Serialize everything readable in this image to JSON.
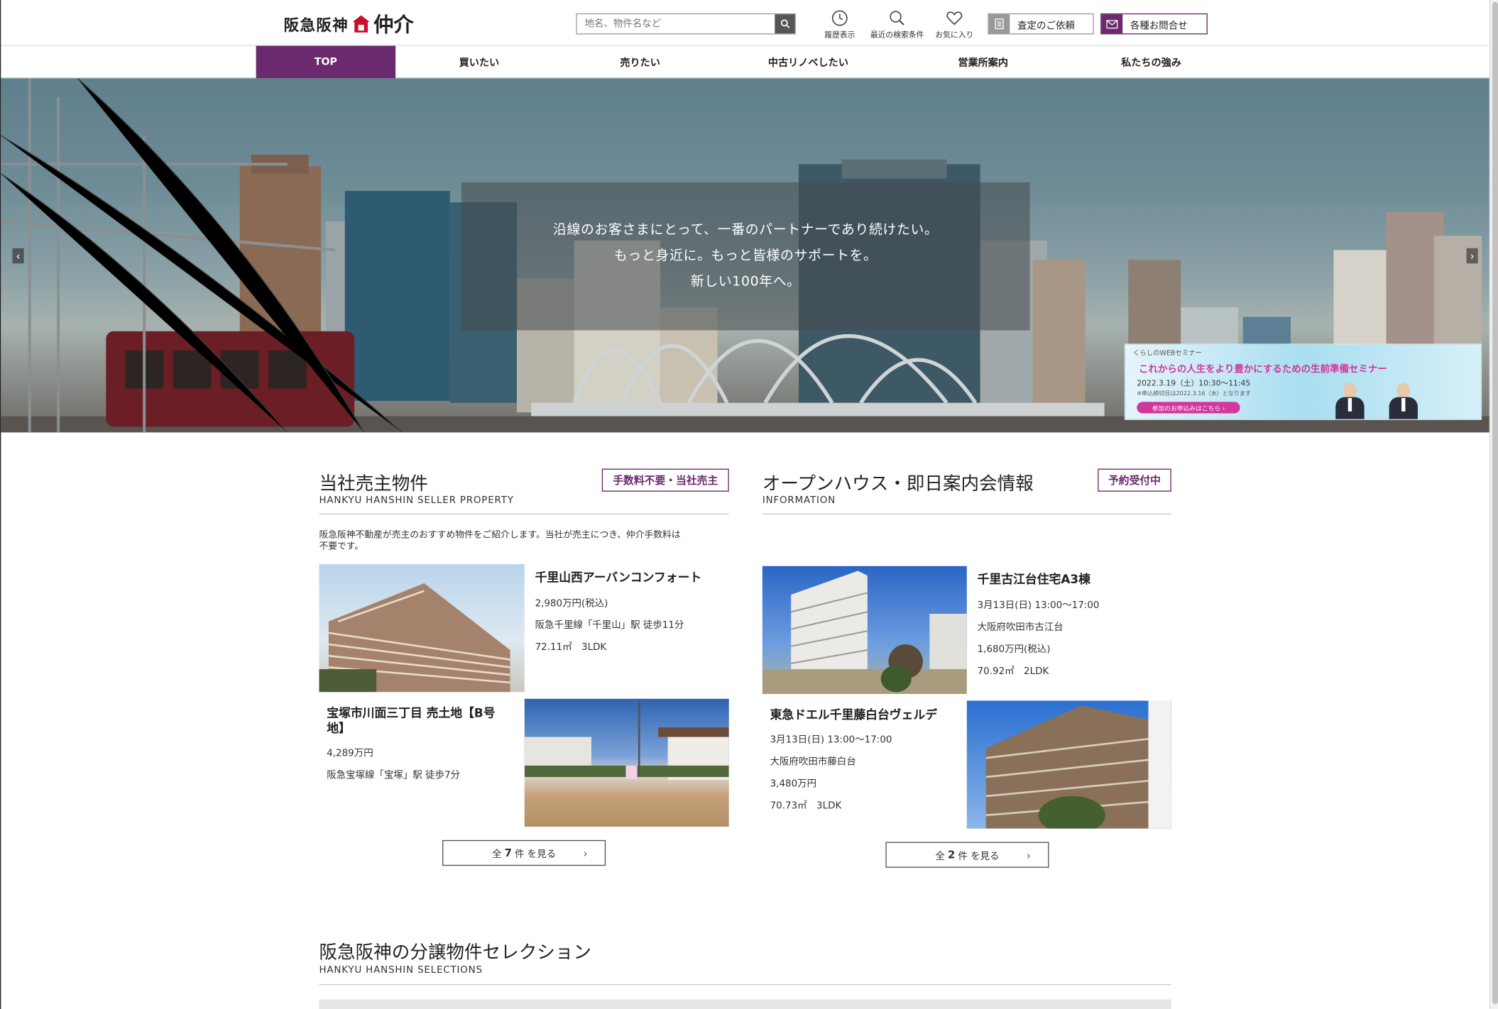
{
  "header": {
    "logo_part1": "阪急阪神",
    "logo_part2": "仲介",
    "search_placeholder": "地名、物件名など",
    "icons": [
      {
        "label": "履歴表示",
        "icon": "clock-icon"
      },
      {
        "label": "最近の検索条件",
        "icon": "search-icon"
      },
      {
        "label": "お気に入り",
        "icon": "heart-icon"
      }
    ],
    "assess_button": "査定のご依頼",
    "contact_button": "各種お問合せ"
  },
  "nav": {
    "items": [
      "TOP",
      "買いたい",
      "売りたい",
      "中古リノベしたい",
      "営業所案内",
      "私たちの強み"
    ],
    "active": "TOP"
  },
  "hero": {
    "line1": "沿線のお客さまにとって、一番のパートナーであり続けたい。",
    "line2": "もっと身近に。もっと皆様のサポートを。",
    "line3": "新しい100年へ。",
    "banner": {
      "label": "くらしのWEBセミナー",
      "title": "これからの人生をより豊かにするための生前準備セミナー",
      "date": "2022.3.19（土）10:30～11:45",
      "deadline": "※申込締切日は2022.3.16（水）となります",
      "cta": "参加のお申込みはこちら ›"
    }
  },
  "seller": {
    "title": "当社売主物件",
    "subtitle": "HANKYU HANSHIN SELLER PROPERTY",
    "tag": "手数料不要・当社売主",
    "desc1": "阪急阪神不動産が売主のおすすめ物件をご紹介します。当社が売主につき、仲介手数料は",
    "desc2": "不要です。",
    "items": [
      {
        "name": "千里山西アーバンコンフォート",
        "price": "2,980万円(税込)",
        "access": "阪急千里線「千里山」駅 徒歩11分",
        "size": "72.11㎡　3LDK"
      },
      {
        "name_l1": "宝塚市川面三丁目 売土地【B号",
        "name_l2": "地】",
        "price": "4,289万円",
        "access": "阪急宝塚線「宝塚」駅 徒歩7分"
      }
    ],
    "more_prefix": "全",
    "more_num": "7",
    "more_suffix": "件 を見る"
  },
  "openhouse": {
    "title": "オープンハウス・即日案内会情報",
    "subtitle": "INFORMATION",
    "tag": "予約受付中",
    "items": [
      {
        "name": "千里古江台住宅A3棟",
        "date": "3月13日(日) 13:00～17:00",
        "address": "大阪府吹田市古江台",
        "price": "1,680万円(税込)",
        "size": "70.92㎡　2LDK"
      },
      {
        "name": "東急ドエル千里藤白台ヴェルデ",
        "date": "3月13日(日) 13:00～17:00",
        "address": "大阪府吹田市藤白台",
        "price": "3,480万円",
        "size": "70.73㎡　3LDK"
      }
    ],
    "more_prefix": "全",
    "more_num": "2",
    "more_suffix": "件 を見る"
  },
  "selection": {
    "title": "阪急阪神の分譲物件セレクション",
    "subtitle": "HANKYU HANSHIN SELECTIONS"
  },
  "colors": {
    "brand_purple": "#6b2a6d",
    "logo_red": "#c8102e"
  }
}
